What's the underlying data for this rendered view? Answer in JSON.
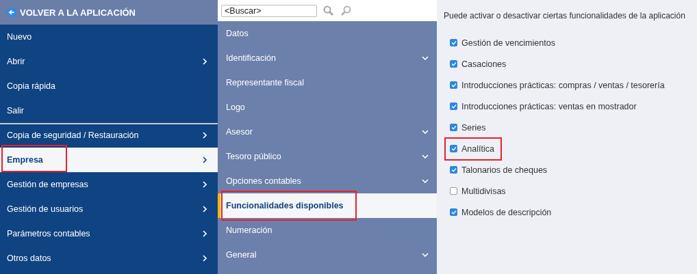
{
  "main_menu": {
    "back_link": "VOLVER A LA APLICACIÓN",
    "items": [
      {
        "label": "Nuevo",
        "has_submenu": false,
        "selected": false,
        "annotated": false,
        "divider_after": false
      },
      {
        "label": "Abrir",
        "has_submenu": true,
        "selected": false,
        "annotated": false,
        "divider_after": false
      },
      {
        "label": "Copia rápida",
        "has_submenu": false,
        "selected": false,
        "annotated": false,
        "divider_after": false
      },
      {
        "label": "Salir",
        "has_submenu": false,
        "selected": false,
        "annotated": false,
        "divider_after": true
      },
      {
        "label": "Copia de seguridad / Restauración",
        "has_submenu": true,
        "selected": false,
        "annotated": false,
        "divider_after": false
      },
      {
        "label": "Empresa",
        "has_submenu": true,
        "selected": true,
        "annotated": true,
        "divider_after": false
      },
      {
        "label": "Gestión de empresas",
        "has_submenu": true,
        "selected": false,
        "annotated": false,
        "divider_after": false
      },
      {
        "label": "Gestión de usuarios",
        "has_submenu": true,
        "selected": false,
        "annotated": false,
        "divider_after": false
      },
      {
        "label": "Parámetros contables",
        "has_submenu": true,
        "selected": false,
        "annotated": false,
        "divider_after": false
      },
      {
        "label": "Otros datos",
        "has_submenu": true,
        "selected": false,
        "annotated": false,
        "divider_after": false
      }
    ]
  },
  "submenu": {
    "search": {
      "value": "<Buscar>"
    },
    "items": [
      {
        "label": "Datos",
        "expandable": false,
        "selected": false,
        "annotated": false
      },
      {
        "label": "Identificación",
        "expandable": true,
        "selected": false,
        "annotated": false
      },
      {
        "label": "Representante fiscal",
        "expandable": false,
        "selected": false,
        "annotated": false
      },
      {
        "label": "Logo",
        "expandable": false,
        "selected": false,
        "annotated": false
      },
      {
        "label": "Asesor",
        "expandable": true,
        "selected": false,
        "annotated": false
      },
      {
        "label": "Tesoro público",
        "expandable": true,
        "selected": false,
        "annotated": false
      },
      {
        "label": "Opciones contables",
        "expandable": true,
        "selected": false,
        "annotated": false
      },
      {
        "label": "Funcionalidades disponibles",
        "expandable": false,
        "selected": true,
        "annotated": true
      },
      {
        "label": "Numeración",
        "expandable": false,
        "selected": false,
        "annotated": false
      },
      {
        "label": "General",
        "expandable": true,
        "selected": false,
        "annotated": false
      }
    ]
  },
  "content": {
    "description": "Puede activar o desactivar ciertas funcionalidades de la aplicación",
    "options": [
      {
        "label": "Gestión de vencimientos",
        "checked": true,
        "annotated": false
      },
      {
        "label": "Casaciones",
        "checked": true,
        "annotated": false
      },
      {
        "label": "Introducciones prácticas: compras / ventas / tesorería",
        "checked": true,
        "annotated": false
      },
      {
        "label": "Introducciones prácticas: ventas en mostrador",
        "checked": true,
        "annotated": false
      },
      {
        "label": "Series",
        "checked": true,
        "annotated": false
      },
      {
        "label": "Analítica",
        "checked": true,
        "annotated": true
      },
      {
        "label": "Talonarios de cheques",
        "checked": true,
        "annotated": false
      },
      {
        "label": "Multidivisas",
        "checked": false,
        "annotated": false
      },
      {
        "label": "Modelos de descripción",
        "checked": true,
        "annotated": false
      }
    ]
  }
}
